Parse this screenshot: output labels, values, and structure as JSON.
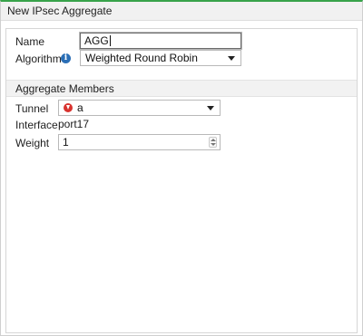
{
  "dialog": {
    "title": "New IPsec Aggregate"
  },
  "form": {
    "name_label": "Name",
    "name_value": "AGG",
    "algorithm_label": "Algorithm",
    "algorithm_value": "Weighted Round Robin"
  },
  "members": {
    "section_title": "Aggregate Members",
    "tunnel_label": "Tunnel",
    "tunnel_value": "a",
    "interface_label": "Interface",
    "interface_value": "port17",
    "weight_label": "Weight",
    "weight_value": "1"
  },
  "icons": {
    "algorithm_info": "info-icon",
    "tunnel_status": "tunnel-down-icon"
  },
  "colors": {
    "title_accent": "#38a34a",
    "info_icon": "#2b6fb6",
    "tunnel_down": "#d8322e"
  }
}
